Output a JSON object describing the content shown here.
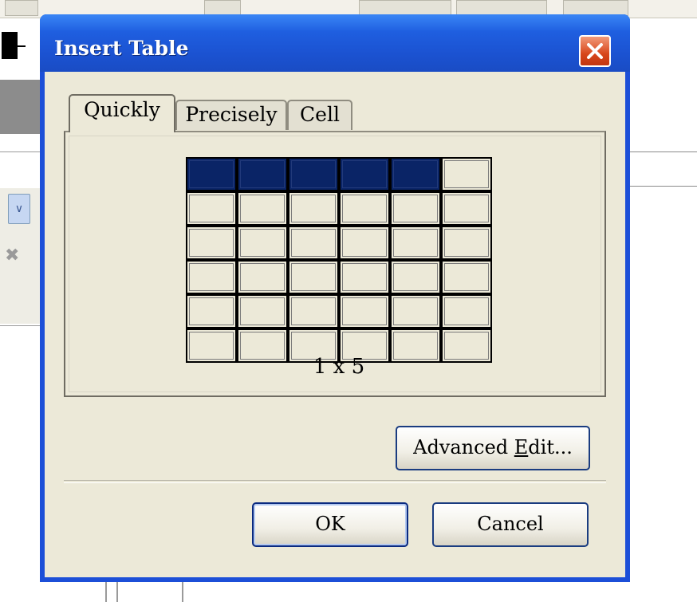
{
  "dialog": {
    "title": "Insert Table",
    "tabs": [
      {
        "label": "Quickly",
        "active": true
      },
      {
        "label": "Precisely",
        "active": false
      },
      {
        "label": "Cell",
        "active": false
      }
    ],
    "grid": {
      "rows": 6,
      "columns": 6,
      "selected_rows": 1,
      "selected_columns": 5
    },
    "size_label": "1 x 5",
    "advanced_edit_label_pre": "Advanced ",
    "advanced_edit_label_accel": "E",
    "advanced_edit_label_post": "dit...",
    "ok_label": "OK",
    "cancel_label": "Cancel"
  },
  "colors": {
    "title_bar": "#1f5fe0",
    "selected_cell": "#0a2466",
    "dialog_face": "#ece9d8",
    "close_button": "#d8471c"
  },
  "icons": {
    "close": "close-icon",
    "background_dropdown": "chevron-down-icon",
    "background_delete": "x-icon"
  }
}
